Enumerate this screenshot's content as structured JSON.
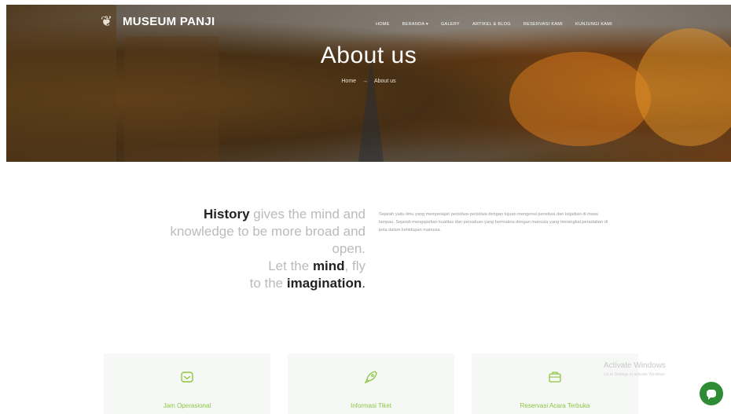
{
  "header": {
    "logo_text": "MUSEUM PANJI",
    "logo_icon": "leaf-ornament-icon",
    "nav": [
      "HOME",
      "BERANDA ▾",
      "GALERY",
      "ARTIKEL & BLOG",
      "RESERVASI KAMI",
      "KUNJUNGI KAMI"
    ]
  },
  "hero": {
    "title": "About us",
    "breadcrumb_home": "Home",
    "breadcrumb_sep": "→",
    "breadcrumb_current": "About us"
  },
  "history": {
    "w1": "History",
    "w2": " gives the mind and",
    "w3": "knowledge to be more broad and",
    "w4": "open.",
    "w5": "Let the ",
    "w6": "mind",
    "w7": ", fly",
    "w8": "to the ",
    "w9": "imagination",
    "w10": "."
  },
  "paragraph": "Sejarah yaitu ilmu yang mempelajari peristiwa-peristiwa dengan tujuan mengenal peristiwa dan kejadian di masa lampau. Sejarah mengajarkan kualitas dan persatuan yang bermakna dengan manusia yang merangkai peradaban di pola dalam kehidupan manusia.",
  "cards": [
    {
      "icon": "envelope-icon",
      "label": "Jam Operasional"
    },
    {
      "icon": "rocket-icon",
      "label": "Informasi Tiket"
    },
    {
      "icon": "briefcase-icon",
      "label": "Reservasi Acara Terbuka"
    }
  ],
  "watermark": {
    "title": "Activate Windows",
    "subtitle": "Go to Settings to activate Windows."
  },
  "colors": {
    "accent": "#8cc63f",
    "chat": "#2e8b36"
  }
}
